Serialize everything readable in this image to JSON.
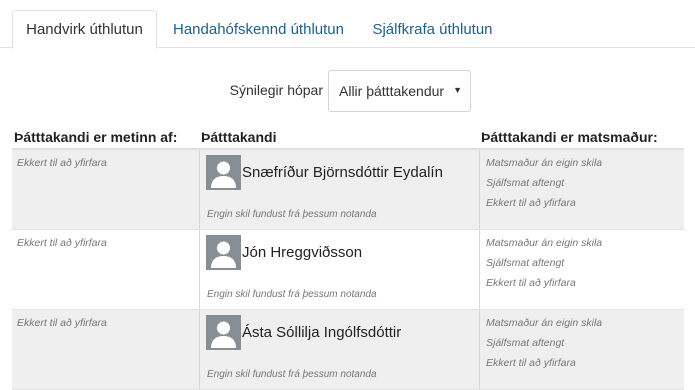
{
  "tabs": [
    {
      "label": "Handvirk úthlutun",
      "active": true
    },
    {
      "label": "Handahófskennd úthlutun",
      "active": false
    },
    {
      "label": "Sjálfkrafa úthlutun",
      "active": false
    }
  ],
  "groups_filter": {
    "label": "Sýnilegir hópar",
    "selected": "Allir þátttakendur"
  },
  "table": {
    "headers": {
      "reviewed_by": "Þátttakandi er metinn af:",
      "participant": "Þátttakandi",
      "is_reviewer_of": "Þátttakandi er matsmaður:"
    },
    "rows": [
      {
        "reviewed_by": "Ekkert til að yfirfara",
        "name": "Snæfríður Björnsdóttir Eydalín",
        "no_submission": "Engin skil fundust frá þessum notanda",
        "reviewer_of": [
          "Matsmaður án eigin skila",
          "Sjálfsmat aftengt",
          "Ekkert til að yfirfara"
        ]
      },
      {
        "reviewed_by": "Ekkert til að yfirfara",
        "name": "Jón Hreggviðsson",
        "no_submission": "Engin skil fundust frá þessum notanda",
        "reviewer_of": [
          "Matsmaður án eigin skila",
          "Sjálfsmat aftengt",
          "Ekkert til að yfirfara"
        ]
      },
      {
        "reviewed_by": "Ekkert til að yfirfara",
        "name": "Ásta Sóllilja Ingólfsdóttir",
        "no_submission": "Engin skil fundust frá þessum notanda",
        "reviewer_of": [
          "Matsmaður án eigin skila",
          "Sjálfsmat aftengt",
          "Ekkert til að yfirfara"
        ]
      }
    ]
  },
  "colors": {
    "link": "#1f5f8b",
    "row_shade": "#efefef",
    "avatar_bg": "#868e96"
  },
  "icons": {
    "avatar": "user-silhouette-icon",
    "caret": "caret-down-icon"
  }
}
